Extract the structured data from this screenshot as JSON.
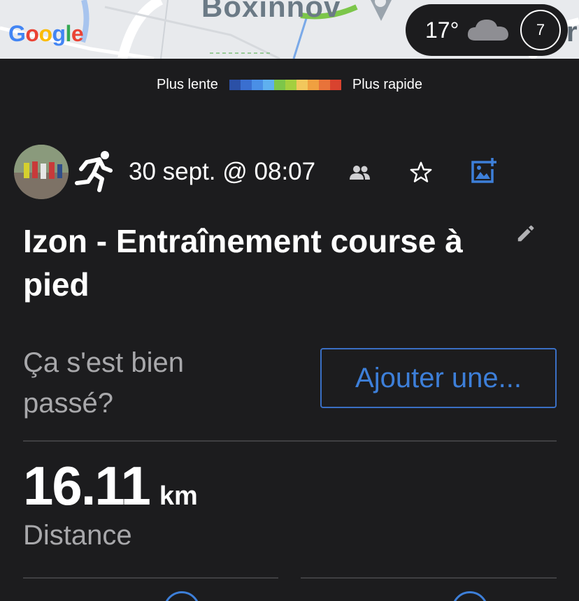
{
  "map": {
    "place_label": "Boxinnov",
    "edge_letter": "r",
    "google_logo": [
      "G",
      "o",
      "o",
      "g",
      "l",
      "e"
    ],
    "weather": {
      "temperature": "17°",
      "condition_icon": "cloud-icon",
      "index_value": "7"
    }
  },
  "pace_legend": {
    "slow_label": "Plus lente",
    "fast_label": "Plus rapide",
    "colors": [
      "#2b50a6",
      "#3a6fd0",
      "#4a8fe6",
      "#5fb0ef",
      "#7cc64a",
      "#a4cf3f",
      "#f2c75c",
      "#f0a040",
      "#e8733a",
      "#d9432f"
    ]
  },
  "activity": {
    "date": "30 sept. @ 08:07",
    "type_icon": "running-icon",
    "title": "Izon - Entraînement course à pied",
    "question": "Ça s'est bien passé?",
    "add_button_label": "Ajouter une..."
  },
  "metrics": {
    "distance_value": "16.11",
    "distance_unit": "km",
    "distance_label": "Distance"
  },
  "colors": {
    "background": "#1c1c1e",
    "accent": "#3d7fd9",
    "muted_text": "#a8a8ab"
  }
}
